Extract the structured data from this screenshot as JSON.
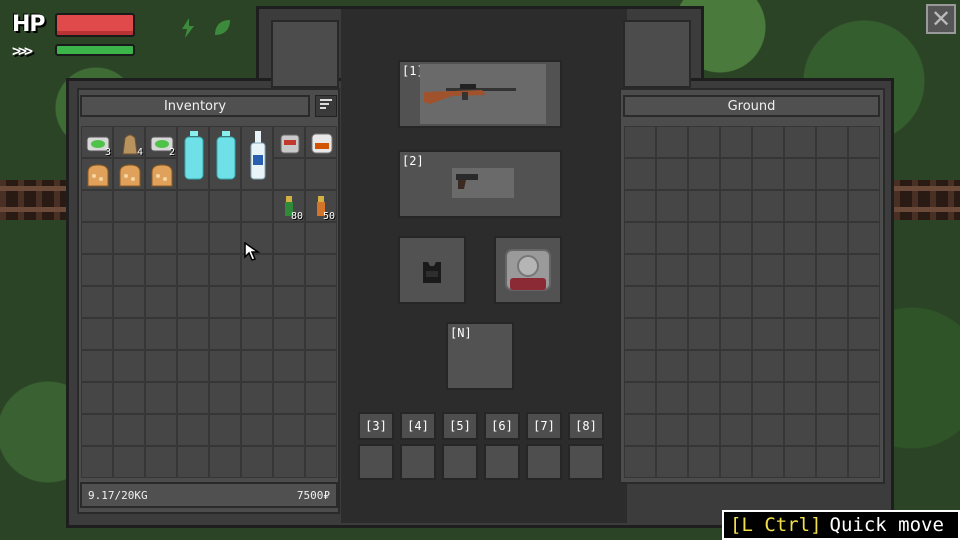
{
  "hud": {
    "hp_label": "HP",
    "stamina_label": ">>>",
    "hp_value": 1.0,
    "stamina_value": 1.0,
    "status_icons": [
      "lightning-icon",
      "leaf-icon"
    ],
    "colors": {
      "hp": "#e04a4a",
      "stamina": "#3bb54a"
    }
  },
  "inventory": {
    "header": "Inventory",
    "sort_icon": "sort-icon",
    "weight": "9.17/20KG",
    "money": "7500₽",
    "items": [
      {
        "name": "medkit-icon",
        "count": "3"
      },
      {
        "name": "bread-bag-icon",
        "count": "4"
      },
      {
        "name": "medkit-icon",
        "count": "2"
      },
      {
        "name": "water-bottle-icon",
        "count": ""
      },
      {
        "name": "water-bottle-icon",
        "count": ""
      },
      {
        "name": "vodka-bottle-icon",
        "count": ""
      },
      {
        "name": "canned-food-icon",
        "count": ""
      },
      {
        "name": "canned-stew-icon",
        "count": ""
      },
      {
        "name": "bread-icon",
        "count": ""
      },
      {
        "name": "bread-icon",
        "count": ""
      },
      {
        "name": "bread-icon",
        "count": ""
      },
      {
        "name": "ammo-green-icon",
        "count": "80"
      },
      {
        "name": "ammo-orange-icon",
        "count": "50"
      }
    ]
  },
  "ground": {
    "header": "Ground"
  },
  "equipment": {
    "primary_tag": "[1]",
    "secondary_tag": "[2]",
    "night_tag": "[N]",
    "primary_icon": "rifle-icon",
    "secondary_icon": "pistol-icon",
    "armor_icon": "body-armor-icon",
    "backpack_icon": "backpack-icon"
  },
  "quickbar": [
    "[3]",
    "[4]",
    "[5]",
    "[6]",
    "[7]",
    "[8]"
  ],
  "hint": {
    "key": "[L Ctrl]",
    "action": "Quick move"
  }
}
